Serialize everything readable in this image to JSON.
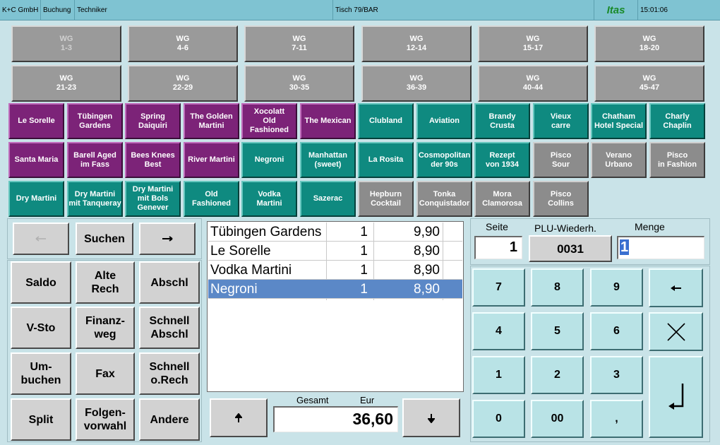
{
  "titlebar": {
    "company": "K+C GmbH",
    "mode": "Buchung",
    "user": "Techniker",
    "table": "Tisch 79/BAR",
    "brand": "Itas",
    "time": "15:01:06"
  },
  "groups": [
    {
      "line1": "WG",
      "line2": "1-3",
      "disabled": true
    },
    {
      "line1": "WG",
      "line2": "4-6"
    },
    {
      "line1": "WG",
      "line2": "7-11"
    },
    {
      "line1": "WG",
      "line2": "12-14"
    },
    {
      "line1": "WG",
      "line2": "15-17"
    },
    {
      "line1": "WG",
      "line2": "18-20"
    },
    {
      "line1": "WG",
      "line2": "21-23"
    },
    {
      "line1": "WG",
      "line2": "22-29"
    },
    {
      "line1": "WG",
      "line2": "30-35"
    },
    {
      "line1": "WG",
      "line2": "36-39"
    },
    {
      "line1": "WG",
      "line2": "40-44"
    },
    {
      "line1": "WG",
      "line2": "45-47"
    }
  ],
  "products": [
    [
      "Le Sorelle",
      "Tübingen\nGardens",
      "Spring\nDaiquiri",
      "The Golden\nMartini",
      "Xocolatt\nOld Fashioned",
      "The Mexican",
      "Clubland",
      "Aviation",
      "Brandy\nCrusta",
      "Vieux\ncarre",
      "Chatham\nHotel Special",
      "Charly\nChaplin"
    ],
    [
      "Santa Maria",
      "Barell Aged\nim Fass",
      "Bees Knees\nBest",
      "River Martini",
      "Negroni",
      "Manhattan\n(sweet)",
      "La Rosita",
      "Cosmopolitan\nder 90s",
      "Rezept\nvon 1934",
      "Pisco\nSour",
      "Verano\nUrbano",
      "Pisco\nin Fashion"
    ],
    [
      "Dry Martini",
      "Dry Martini\nmit Tanqueray",
      "Dry Martini\nmit Bols Genever",
      "Old\nFashioned",
      "Vodka\nMartini",
      "Sazerac",
      "Hepburn\nCocktail",
      "Tonka\nConquistador",
      "Mora\nClamorosa",
      "Pisco\nCollins",
      "",
      ""
    ]
  ],
  "product_colors": [
    [
      "purple",
      "purple",
      "purple",
      "purple",
      "purple",
      "purple",
      "teal",
      "teal",
      "teal",
      "teal",
      "teal",
      "teal"
    ],
    [
      "purple",
      "purple",
      "purple",
      "purple",
      "teal",
      "teal",
      "teal",
      "teal",
      "teal",
      "gray",
      "gray",
      "gray"
    ],
    [
      "teal",
      "teal",
      "teal",
      "teal",
      "teal",
      "teal",
      "gray",
      "gray",
      "gray",
      "gray",
      "",
      ""
    ]
  ],
  "nav": {
    "prev_icon": "arrow-left-icon",
    "search": "Suchen",
    "next_icon": "arrow-right-icon"
  },
  "functions": [
    "Saldo",
    "Alte\nRech",
    "Abschl",
    "V-Sto",
    "Finanz-\nweg",
    "Schnell\nAbschl",
    "Um-\nbuchen",
    "Fax",
    "Schnell\no.Rech",
    "Split",
    "Folgen-\nvorwahl",
    "Andere"
  ],
  "order": {
    "items": [
      {
        "name": "Tübingen Gardens",
        "qty": "1",
        "price": "9,90",
        "selected": false
      },
      {
        "name": "Le Sorelle",
        "qty": "1",
        "price": "8,90",
        "selected": false
      },
      {
        "name": "Vodka Martini",
        "qty": "1",
        "price": "8,90",
        "selected": false
      },
      {
        "name": "Negroni",
        "qty": "1",
        "price": "8,90",
        "selected": true
      }
    ],
    "total_label": "Gesamt",
    "currency_label": "Eur",
    "total": "36,60",
    "scroll_up_icon": "arrow-up-icon",
    "scroll_down_icon": "arrow-down-icon"
  },
  "entry": {
    "page_label": "Seite",
    "page_value": "1",
    "plu_label": "PLU-Wiederh.",
    "plu_value": "0031",
    "qty_label": "Menge",
    "qty_value": "1"
  },
  "keypad": {
    "k7": "7",
    "k8": "8",
    "k9": "9",
    "k4": "4",
    "k5": "5",
    "k6": "6",
    "k1": "1",
    "k2": "2",
    "k3": "3",
    "k0": "0",
    "k00": "00",
    "kcomma": ",",
    "backspace_icon": "backspace-arrow-icon",
    "clear_icon": "cross-icon",
    "enter_icon": "enter-icon"
  }
}
